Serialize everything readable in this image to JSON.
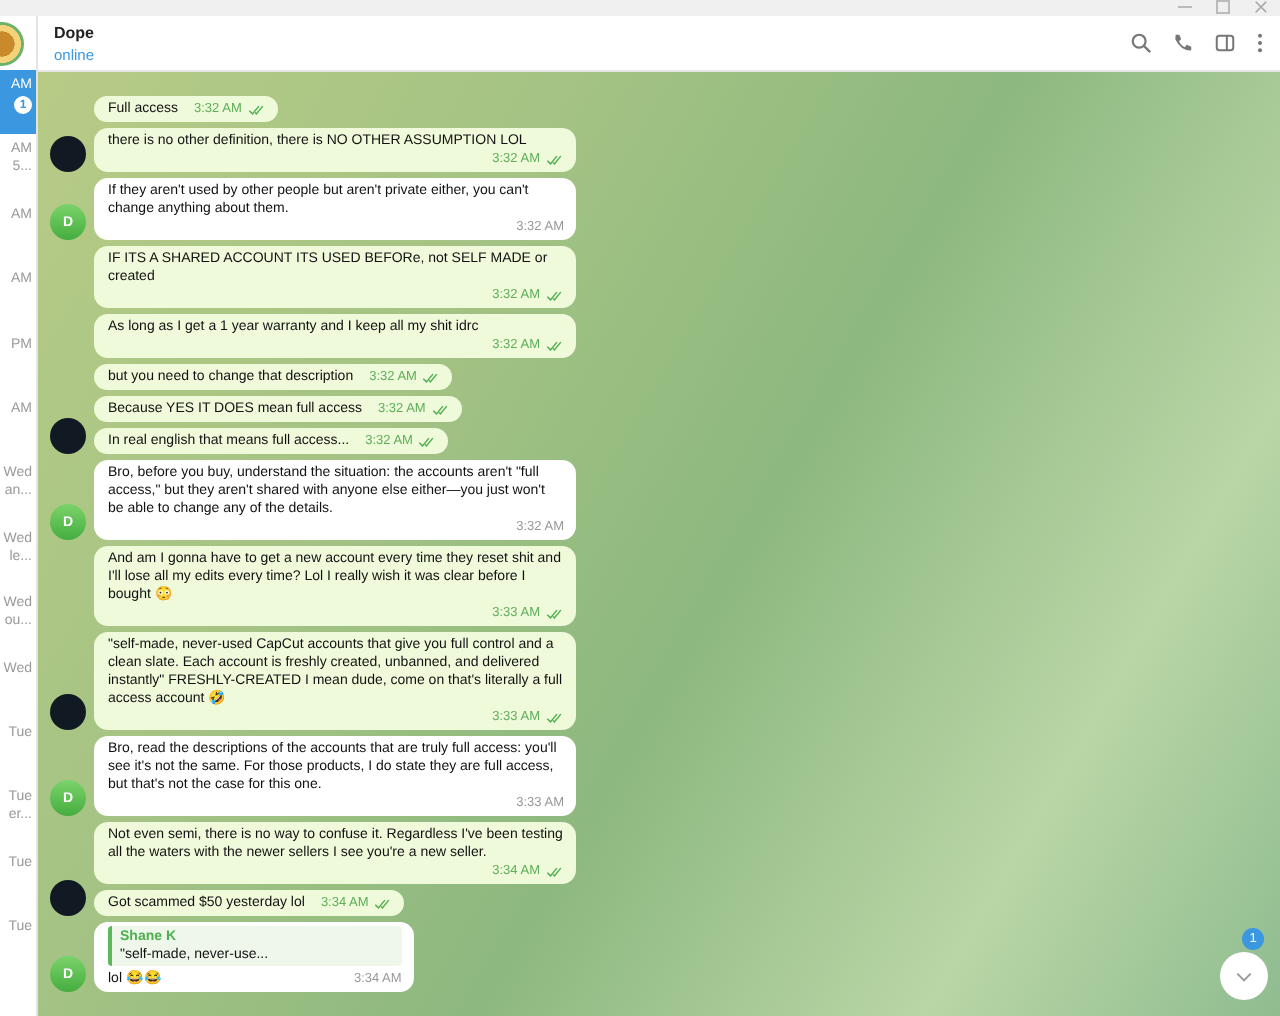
{
  "chat_list": {
    "items": [
      {
        "time": "AM",
        "badge": "1",
        "selected": true
      },
      {
        "time": "AM",
        "preview": "5...",
        "selected": false
      },
      {
        "time": "AM",
        "selected": false
      },
      {
        "time": "AM",
        "selected": false
      },
      {
        "time": "PM",
        "selected": false
      },
      {
        "time": "AM",
        "selected": false
      },
      {
        "time": "Wed",
        "preview": "an...",
        "selected": false
      },
      {
        "time": "Wed",
        "preview": "le...",
        "selected": false
      },
      {
        "time": "Wed",
        "preview": "ou...",
        "selected": false
      },
      {
        "time": "Wed",
        "selected": false
      },
      {
        "time": "Tue",
        "selected": false
      },
      {
        "time": "Tue",
        "preview": "er...",
        "selected": false
      },
      {
        "time": "Tue",
        "selected": false
      },
      {
        "time": "Tue",
        "selected": false
      }
    ]
  },
  "header": {
    "name": "Dope",
    "status": "online"
  },
  "groups": [
    {
      "kind": "outgoing",
      "messages": [
        {
          "text": "Full access",
          "time": "3:32 AM",
          "read": true
        },
        {
          "text": "there is no other definition, there is NO OTHER ASSUMPTION LOL",
          "time": "3:32 AM",
          "read": true
        }
      ]
    },
    {
      "kind": "incoming",
      "avatar": "D",
      "messages": [
        {
          "text": "If they aren't used by other people but aren't private either, you can't change anything about them.",
          "time": "3:32 AM"
        }
      ]
    },
    {
      "kind": "outgoing",
      "messages": [
        {
          "text": "IF ITS A SHARED ACCOUNT ITS USED BEFORe, not SELF MADE or created",
          "time": "3:32 AM",
          "read": true
        },
        {
          "text": "As long as I get a 1 year warranty and I keep all my shit idrc",
          "time": "3:32 AM",
          "read": true
        },
        {
          "text": "but you need to change that description",
          "time": "3:32 AM",
          "read": true
        },
        {
          "text": "Because YES IT DOES mean full access",
          "time": "3:32 AM",
          "read": true
        },
        {
          "text": "In real english that means full access...",
          "time": "3:32 AM",
          "read": true
        }
      ]
    },
    {
      "kind": "incoming",
      "avatar": "D",
      "messages": [
        {
          "text": "Bro, before you buy, understand the situation: the accounts aren't \"full access,\" but they aren't shared with anyone else either—you just won't be able to change any of the details.",
          "time": "3:32 AM"
        }
      ]
    },
    {
      "kind": "outgoing",
      "messages": [
        {
          "text": "And am I gonna have to get a new account every time they reset shit and I'll lose all my edits every time? Lol I really wish it was clear before I bought 😳",
          "time": "3:33 AM",
          "read": true
        },
        {
          "text": "\"self-made, never-used CapCut accounts that give you full control and a clean slate. Each account is freshly created, unbanned, and delivered instantly\" FRESHLY-CREATED I mean dude, come on that's literally a full access account 🤣",
          "time": "3:33 AM",
          "read": true
        }
      ]
    },
    {
      "kind": "incoming",
      "avatar": "D",
      "messages": [
        {
          "text": "Bro, read the descriptions of the accounts that are truly full access: you'll see it's not the same. For those products, I do state they are full access, but that's not the case for this one.",
          "time": "3:33 AM"
        }
      ]
    },
    {
      "kind": "outgoing",
      "messages": [
        {
          "text": "Not even semi, there is no way to confuse it. Regardless I've been testing all the waters with the newer sellers I see you're a new seller.",
          "time": "3:34 AM",
          "read": true
        },
        {
          "text": "Got scammed $50 yesterday lol",
          "time": "3:34 AM",
          "read": true
        }
      ]
    },
    {
      "kind": "incoming",
      "avatar": "D",
      "messages": [
        {
          "reply_author": "Shane K",
          "reply_text": "\"self-made, never-use...",
          "text": "lol 😂😂",
          "time": "3:34 AM"
        }
      ]
    }
  ],
  "scroll_button": {
    "badge": "1"
  }
}
